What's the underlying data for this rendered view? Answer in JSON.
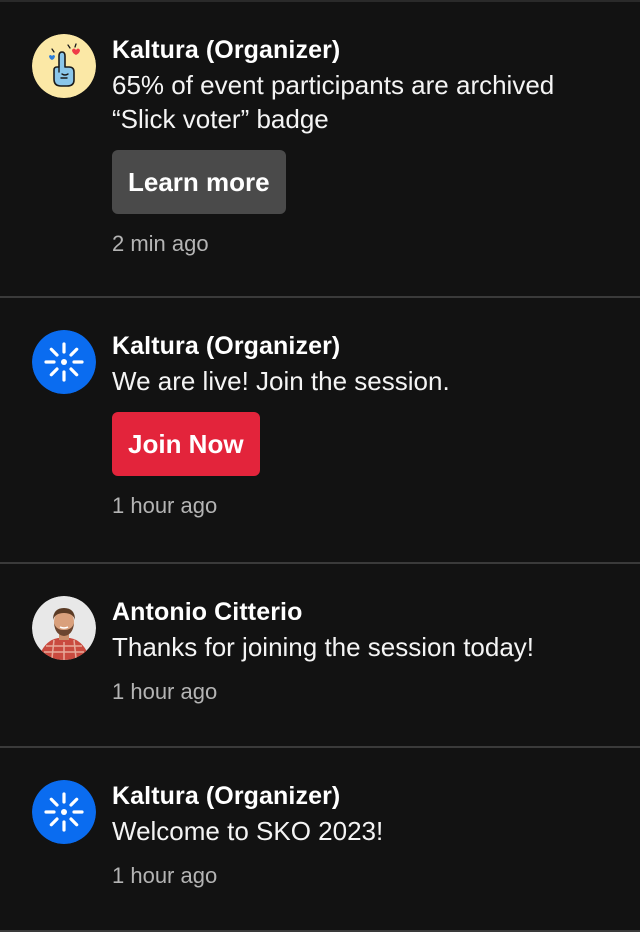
{
  "colors": {
    "background": "#121212",
    "divider": "#3a3a3a",
    "secondary_button": "#4a4a4a",
    "primary_button": "#e3243b",
    "kaltura_brand": "#0a6cf0",
    "timestamp": "#b4b4b4"
  },
  "notifications": [
    {
      "sender": "Kaltura (Organizer)",
      "avatar_icon": "slick-voter-badge-icon",
      "message": "65% of event participants are archived “Slick voter” badge",
      "button_label": "Learn more",
      "time": "2 min ago"
    },
    {
      "sender": "Kaltura (Organizer)",
      "avatar_icon": "kaltura-logo-icon",
      "message": "We are live! Join the session.",
      "button_label": "Join Now",
      "time": "1 hour ago"
    },
    {
      "sender": "Antonio Citterio",
      "avatar_icon": "user-photo-icon",
      "message": "Thanks for joining the session today!",
      "time": "1 hour ago"
    },
    {
      "sender": "Kaltura (Organizer)",
      "avatar_icon": "kaltura-logo-icon",
      "message": "Welcome to SKO 2023!",
      "time": "1 hour ago"
    }
  ]
}
